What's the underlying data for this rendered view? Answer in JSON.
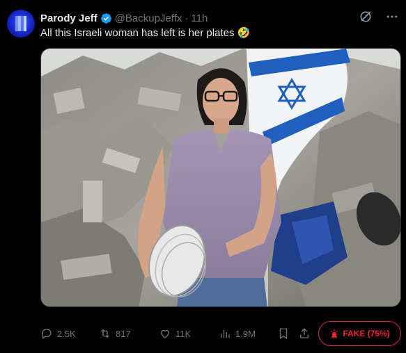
{
  "author": {
    "name": "Parody Jeff",
    "handle": "@BackupJeffx",
    "separator": "·",
    "time": "11h"
  },
  "tweet": {
    "text": "All this Israeli woman has left is her plates 🤣"
  },
  "media": {
    "description_icon": "photo"
  },
  "actions": {
    "replies": "2.5K",
    "retweets": "817",
    "likes": "11K",
    "views": "1.9M"
  },
  "badge": {
    "label": "FAKE (75%)"
  },
  "colors": {
    "background": "#000000",
    "text": "#e7e9ea",
    "muted": "#71767b",
    "verified": "#1d9bf0",
    "fake": "#f4212e"
  }
}
